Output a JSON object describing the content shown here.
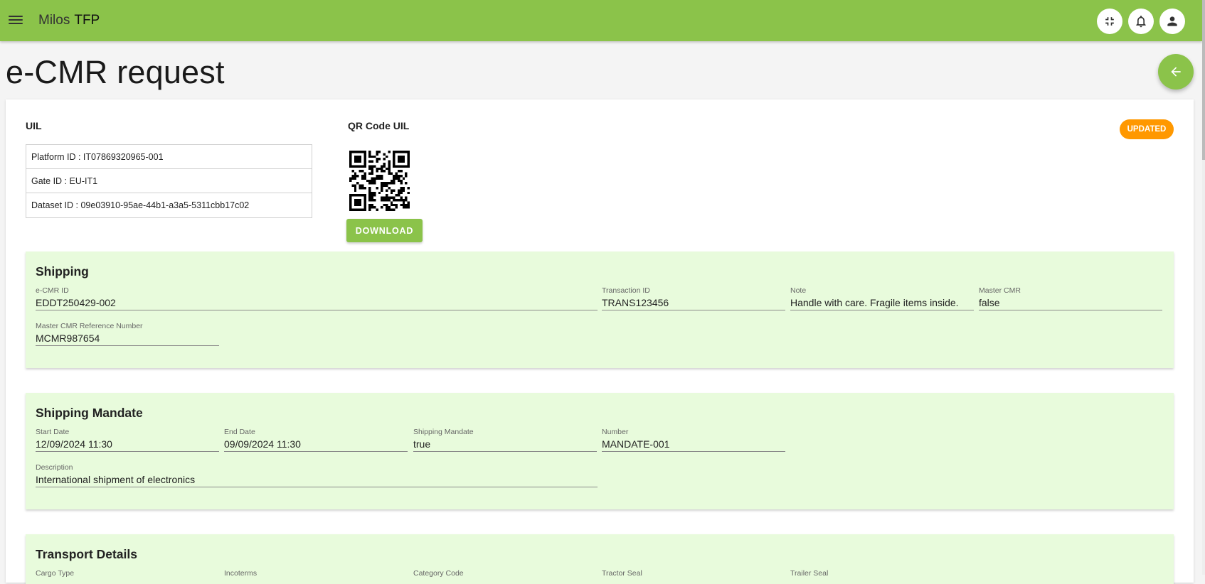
{
  "header": {
    "app_name": "Milos",
    "app_sub": "TFP",
    "icons": [
      "menu-icon",
      "collapse-icon",
      "bell-icon",
      "user-icon"
    ]
  },
  "page": {
    "title": "e-CMR request"
  },
  "uil": {
    "label": "UIL",
    "rows": [
      "Platform ID : IT07869320965-001",
      "Gate ID : EU-IT1",
      "Dataset ID : 09e03910-95ae-44b1-a3a5-5311cbb17c02"
    ]
  },
  "qr": {
    "label": "QR Code UIL",
    "download_label": "DOWNLOAD"
  },
  "status": {
    "label": "UPDATED",
    "color": "#ff9800"
  },
  "shipping": {
    "title": "Shipping",
    "ecmr_id": {
      "label": "e-CMR ID",
      "value": "EDDT250429-002"
    },
    "transaction_id": {
      "label": "Transaction ID",
      "value": "TRANS123456"
    },
    "note": {
      "label": "Note",
      "value": "Handle with care. Fragile items inside."
    },
    "master_cmr": {
      "label": "Master CMR",
      "value": "false"
    },
    "master_ref": {
      "label": "Master CMR Reference Number",
      "value": "MCMR987654"
    }
  },
  "mandate": {
    "title": "Shipping Mandate",
    "start_date": {
      "label": "Start Date",
      "value": "12/09/2024 11:30"
    },
    "end_date": {
      "label": "End Date",
      "value": "09/09/2024 11:30"
    },
    "shipping_mandate": {
      "label": "Shipping Mandate",
      "value": "true"
    },
    "number": {
      "label": "Number",
      "value": "MANDATE-001"
    },
    "description": {
      "label": "Description",
      "value": "International shipment of electronics"
    }
  },
  "transport": {
    "title": "Transport Details",
    "cargo_type": {
      "label": "Cargo Type"
    },
    "incoterms": {
      "label": "Incoterms"
    },
    "category_code": {
      "label": "Category Code"
    },
    "tractor_seal": {
      "label": "Tractor Seal"
    },
    "trailer_seal": {
      "label": "Trailer Seal"
    }
  },
  "colors": {
    "primary": "#8bc34a",
    "section_bg": "#e8fbdc",
    "badge": "#ff9800"
  }
}
